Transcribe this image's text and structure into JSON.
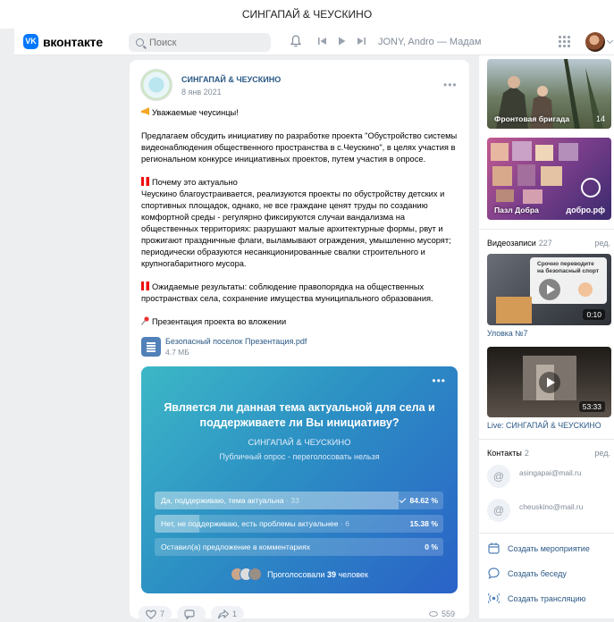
{
  "window": {
    "title": "СИНГАПАЙ & ЧЕУСКИНО"
  },
  "header": {
    "logo_mark": "VK",
    "logo_text": "вконтакте",
    "search_placeholder": "Поиск",
    "now_playing": "JONY, Andro — Мадам"
  },
  "post": {
    "author": "СИНГАПАЙ & ЧЕУСКИНО",
    "date": "8 янв 2021",
    "more": "•••",
    "greeting": "Уважаемые чеусинцы!",
    "intro": "Предлагаем обсудить инициативу по разработке проекта \"Обустройство системы видеонаблюдения общественного пространства в с.Чеускино\", в целях участия в региональном конкурсе инициативных проектов, путем участия в опросе.",
    "why_title": "Почему это актуально",
    "why_text": "Чеускино благоустраивается, реализуются проекты по обустройству детских и спортивных площадок, однако, не все граждане ценят труды по созданию комфортной среды - регулярно фиксируются случаи вандализма на общественных территориях: разрушают малые архитектурные формы, рвут и прожигают праздничные флаги, выламывают ограждения, умышленно мусорят; периодически образуются несанкционированные свалки строительного и крупногабаритного мусора.",
    "results": "Ожидаемые результаты: соблюдение правопорядка на общественных пространствах села, сохранение имущества муниципального образования.",
    "attachment_note": "Презентация проекта во вложении",
    "file": {
      "name": "Безопасный поселок Презентация.pdf",
      "size": "4.7 МБ"
    },
    "poll": {
      "more": "•••",
      "question": "Является ли данная тема актуальной для села и поддерживаете ли Вы инициативу?",
      "author": "СИНГАПАЙ & ЧЕУСКИНО",
      "type": "Публичный опрос - переголосовать нельзя",
      "options": [
        {
          "label": "Да, поддерживаю, тема актуальна",
          "count": "· 33",
          "percent": "84.62 %",
          "share": 0.8462,
          "chosen": true
        },
        {
          "label": "Нет, не поддерживаю, есть проблемы актуальнее",
          "count": "· 6",
          "percent": "15.38 %",
          "share": 0.1538,
          "chosen": false
        },
        {
          "label": "Оставил(а) предложение в комментариях",
          "count": "",
          "percent": "0 %",
          "share": 0,
          "chosen": false
        }
      ],
      "voted_prefix": "Проголосовали",
      "voted_count": "39",
      "voted_suffix": "человек"
    },
    "likes": "7",
    "shares": "1",
    "views": "559"
  },
  "sidebar": {
    "photo_albums": [
      {
        "caption": "Фронтовая бригада",
        "count": "14"
      },
      {
        "caption": "Пазл Добра",
        "badge": "добро.рф"
      }
    ],
    "videos": {
      "title": "Видеозаписи",
      "count": "227",
      "edit": "ред.",
      "items": [
        {
          "title": "Уловка №7",
          "duration": "0:10",
          "overlay": "Срочно переводите на безопасный спорт"
        },
        {
          "title": "Live: СИНГАПАЙ & ЧЕУСКИНО",
          "duration": "53:33"
        }
      ]
    },
    "contacts": {
      "title": "Контакты",
      "count": "2",
      "edit": "ред.",
      "items": [
        {
          "email": "asingapai@mail.ru"
        },
        {
          "email": "cheuskino@mail.ru"
        }
      ]
    },
    "links": [
      {
        "label": "Создать мероприятие",
        "icon": "calendar-icon"
      },
      {
        "label": "Создать беседу",
        "icon": "chat-bubble-icon"
      },
      {
        "label": "Создать трансляцию",
        "icon": "broadcast-icon"
      }
    ]
  },
  "colors": {
    "accent": "#0077ff",
    "link": "#2a5885",
    "muted": "#818c99",
    "bg": "#edeef0"
  }
}
